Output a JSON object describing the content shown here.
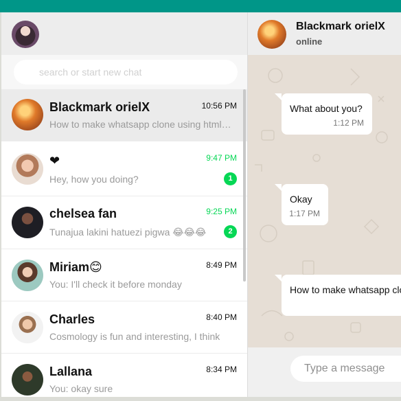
{
  "search": {
    "placeholder": "search or start new chat"
  },
  "chats": [
    {
      "name": "Blackmark orielX",
      "time": "10:56 PM",
      "preview": "How to make whatsapp clone using html css",
      "unread": ""
    },
    {
      "name": "❤",
      "time": "9:47 PM",
      "preview": "Hey, how you doing?",
      "unread": "1"
    },
    {
      "name": "chelsea fan",
      "time": "9:25 PM",
      "preview": "Tunajua lakini hatuezi pigwa 😂😂😂",
      "unread": "2"
    },
    {
      "name": "Miriam😊",
      "time": "8:49 PM",
      "preview": "You: I'll check it before monday",
      "unread": ""
    },
    {
      "name": "Charles",
      "time": "8:40 PM",
      "preview": "Cosmology is fun and interesting, I think",
      "unread": ""
    },
    {
      "name": "Lallana",
      "time": "8:34 PM",
      "preview": "You: okay sure",
      "unread": ""
    }
  ],
  "conversation": {
    "name": "Blackmark orielX",
    "status": "online",
    "messages": [
      {
        "text": "What about you?",
        "time": "1:12 PM"
      },
      {
        "text": "Okay",
        "time": "1:17 PM"
      },
      {
        "text": "How to make whatsapp clone using html css",
        "time": ""
      }
    ]
  },
  "composer": {
    "placeholder": "Type a message"
  },
  "colors": {
    "brand": "#009688",
    "unread": "#06d755",
    "chat_background": "#e6ded5"
  }
}
